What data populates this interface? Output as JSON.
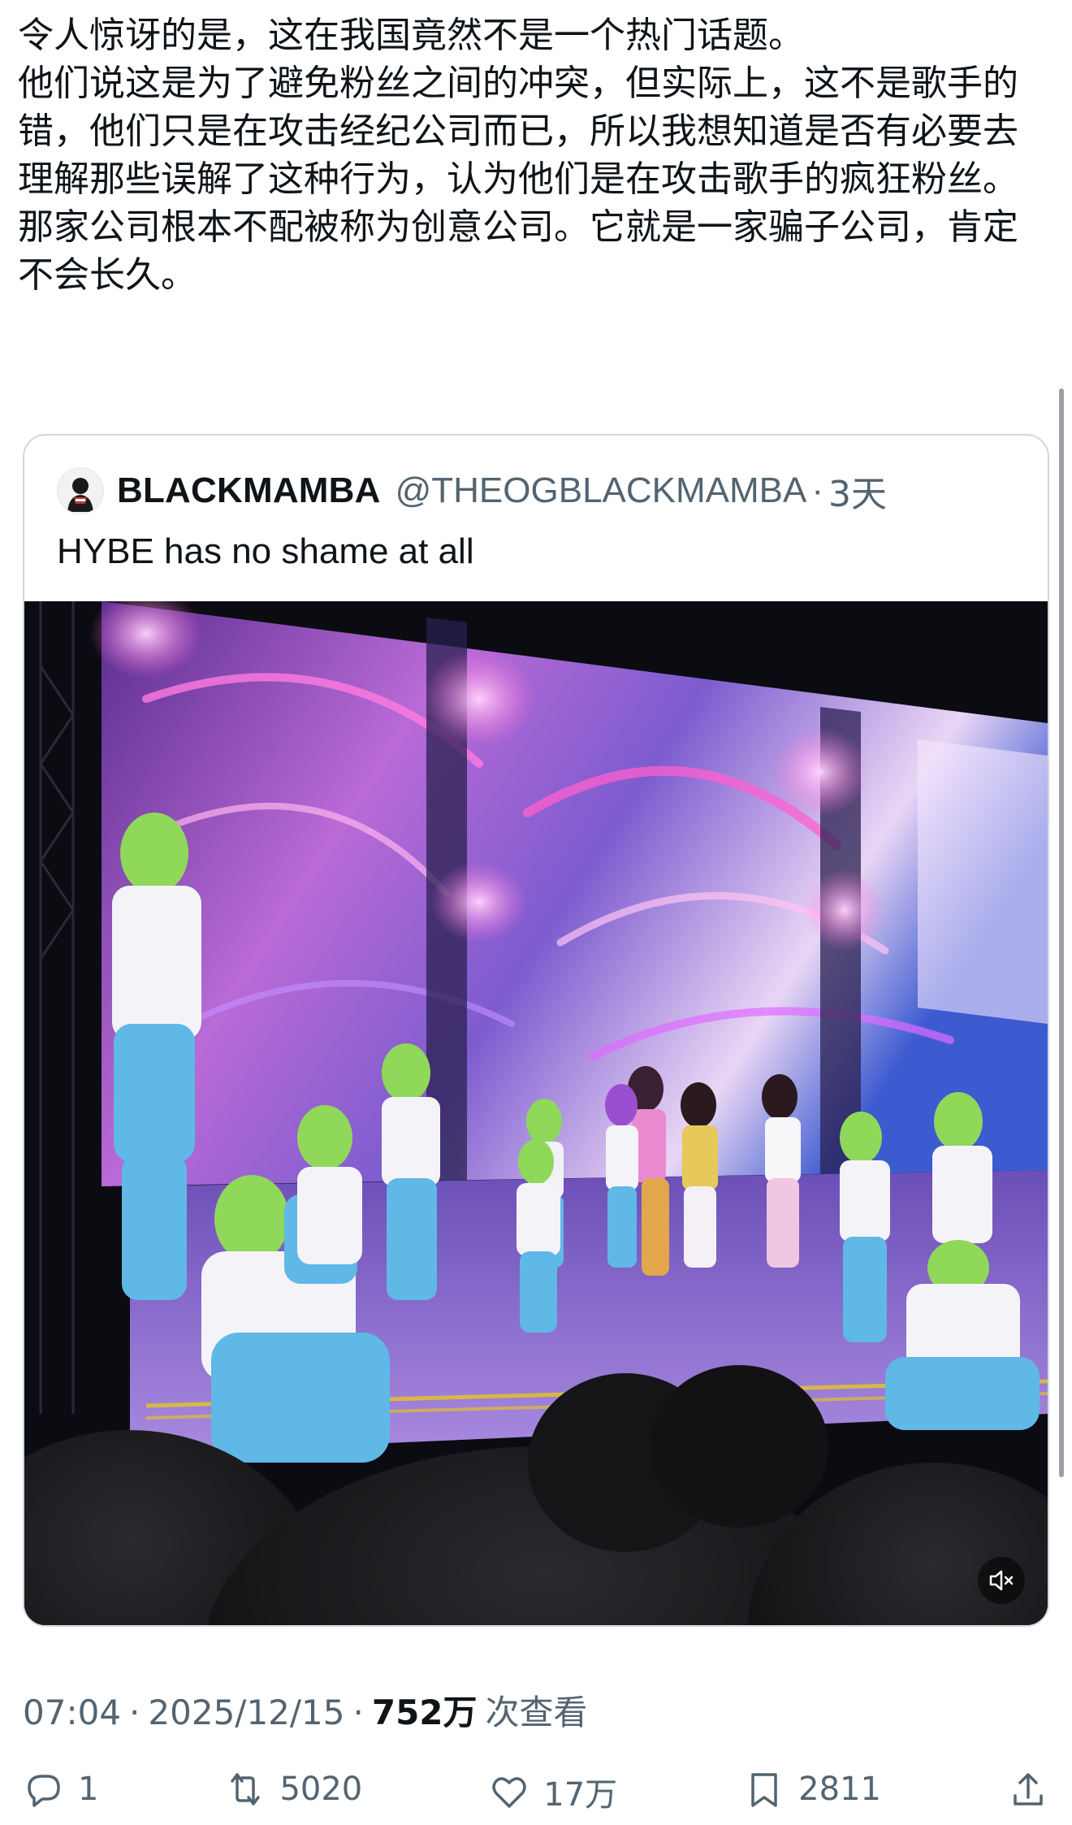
{
  "post": {
    "paragraphs": [
      "令人惊讶的是，这在我国竟然不是一个热门话题。",
      "他们说这是为了避免粉丝之间的冲突，但实际上，这不是歌手的错，他们只是在攻击经纪公司而已，所以我想知道是否有必要去理解那些误解了这种行为，认为他们是在攻击歌手的疯狂粉丝。",
      "那家公司根本不配被称为创意公司。它就是一家骗子公司，肯定不会长久。"
    ]
  },
  "quote": {
    "author_name": "BLACKMAMBA",
    "author_handle": "@THEOGBLACKMAMBA",
    "separator": "·",
    "time": "3天",
    "text": "HYBE has no shame at all",
    "video": {
      "mute_icon": "speaker-muted-icon"
    }
  },
  "meta": {
    "time": "07:04",
    "separator": "·",
    "date": "2025/12/15",
    "views_count": "752万",
    "views_label": "次查看"
  },
  "actions": {
    "reply_count": "1",
    "repost_count": "5020",
    "like_count": "17万",
    "bookmark_count": "2811",
    "icons": [
      "reply-icon",
      "repost-icon",
      "like-icon",
      "bookmark-icon",
      "share-icon"
    ]
  },
  "colors": {
    "text_primary": "#0f1419",
    "text_secondary": "#536471",
    "card_border": "#cfd9de",
    "stage_purple": "#7a4fd0",
    "dancer_green": "#8fd85a",
    "dancer_blue": "#5fb8e6"
  }
}
